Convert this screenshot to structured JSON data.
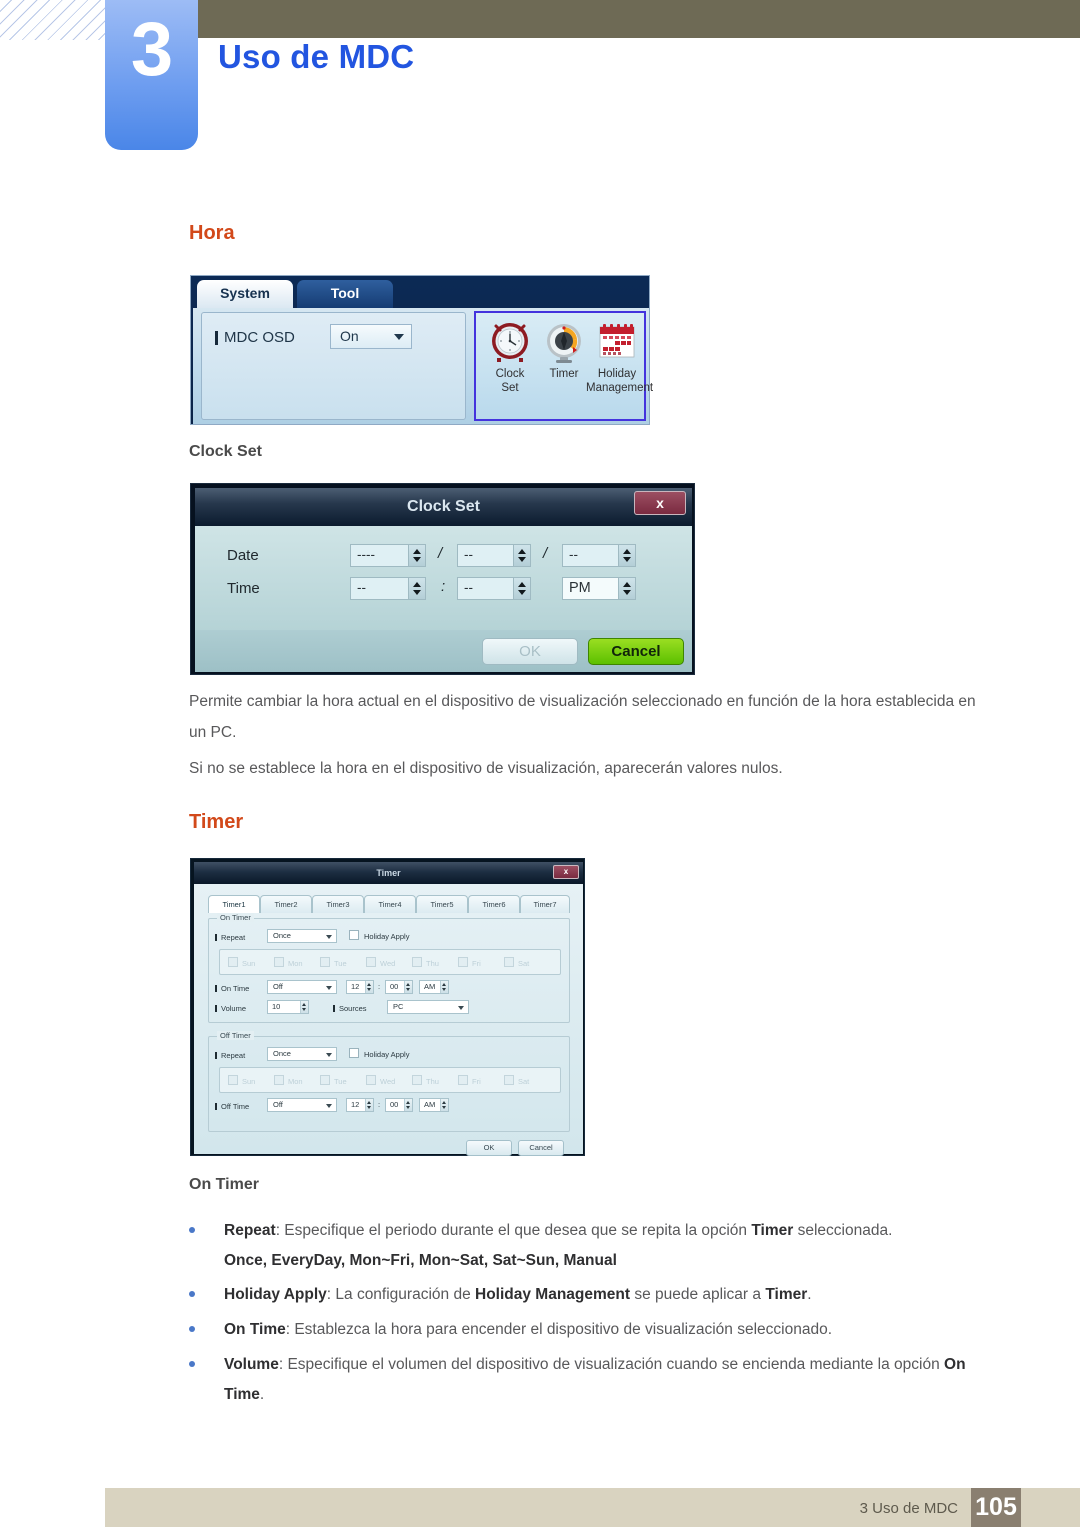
{
  "header": {
    "chapter_number": "3",
    "chapter_title": "Uso de MDC"
  },
  "sections": {
    "hora_heading": "Hora",
    "clock_set_heading": "Clock Set",
    "timer_heading": "Timer",
    "on_timer_heading": "On Timer"
  },
  "mdc_panel": {
    "tab_system": "System",
    "tab_tool": "Tool",
    "osd_label": "MDC OSD",
    "osd_value": "On",
    "icons": [
      {
        "name": "clock-set",
        "line1": "Clock",
        "line2": "Set"
      },
      {
        "name": "timer",
        "line1": "Timer",
        "line2": ""
      },
      {
        "name": "holiday-management",
        "line1": "Holiday",
        "line2": "Management"
      }
    ]
  },
  "clock_set_dialog": {
    "title": "Clock Set",
    "close_label": "x",
    "date_label": "Date",
    "time_label": "Time",
    "date_year": "----",
    "date_month": "--",
    "date_day": "--",
    "time_hour": "--",
    "time_minute": "--",
    "time_ampm": "PM",
    "separator": "/",
    "time_separator": ":",
    "ok_label": "OK",
    "cancel_label": "Cancel"
  },
  "timer_dialog": {
    "title": "Timer",
    "close_label": "x",
    "tabs": [
      "Timer1",
      "Timer2",
      "Timer3",
      "Timer4",
      "Timer5",
      "Timer6",
      "Timer7"
    ],
    "on_timer": {
      "group_title": "On Timer",
      "repeat_label": "Repeat",
      "repeat_value": "Once",
      "holiday_apply_label": "Holiday Apply",
      "days": [
        "Sun",
        "Mon",
        "Tue",
        "Wed",
        "Thu",
        "Fri",
        "Sat"
      ],
      "on_time_label": "On Time",
      "on_time_value": "Off",
      "hour": "12",
      "minute": "00",
      "ampm": "AM",
      "volume_label": "Volume",
      "volume_value": "10",
      "sources_label": "Sources",
      "sources_value": "PC"
    },
    "off_timer": {
      "group_title": "Off Timer",
      "repeat_label": "Repeat",
      "repeat_value": "Once",
      "holiday_apply_label": "Holiday Apply",
      "days": [
        "Sun",
        "Mon",
        "Tue",
        "Wed",
        "Thu",
        "Fri",
        "Sat"
      ],
      "off_time_label": "Off Time",
      "off_time_value": "Off",
      "hour": "12",
      "minute": "00",
      "ampm": "AM"
    },
    "ok_label": "OK",
    "cancel_label": "Cancel"
  },
  "body": {
    "paragraph_1": "Permite cambiar la hora actual en el dispositivo de visualización seleccionado en función de la hora establecida en un PC.",
    "paragraph_2": "Si no se establece la hora en el dispositivo de visualización, aparecerán valores nulos."
  },
  "bullets": [
    {
      "term": "Repeat",
      "rest": ": Especifique el periodo durante el que desea que se repita la opción ",
      "bold2": "Timer",
      "rest2": " seleccionada.",
      "options": "Once, EveryDay, Mon~Fri, Mon~Sat, Sat~Sun, Manual"
    },
    {
      "term": "Holiday Apply",
      "rest": ": La configuración de ",
      "bold2": "Holiday Management",
      "rest2": " se puede aplicar a  ",
      "bold3": "Timer",
      "rest3": "."
    },
    {
      "term": "On Time",
      "rest": ": Establezca la hora para encender el dispositivo de visualización seleccionado."
    },
    {
      "term": "Volume",
      "rest": ": Especifique el volumen del dispositivo de visualización cuando se encienda mediante la opción ",
      "bold2": "On Time",
      "rest2": "."
    }
  ],
  "footer": {
    "text": "3 Uso de MDC",
    "page_number": "105"
  },
  "colors": {
    "chapter_blue": "#4a86e8",
    "title_blue": "#2255e0",
    "heading_orange": "#d2491a",
    "olive": "#6e6a55",
    "footer_beige": "#d9d3c0",
    "footer_page_brown": "#8a7f70",
    "bullet_blue": "#4a78c8"
  }
}
